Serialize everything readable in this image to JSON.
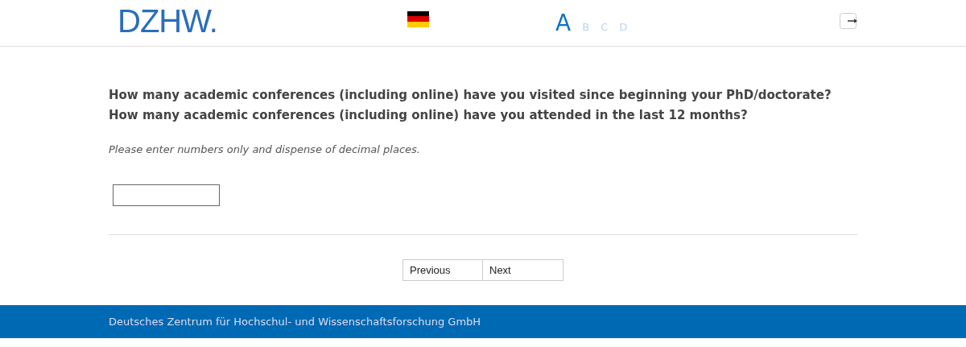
{
  "header": {
    "logo": "DZHW.",
    "font_sizes": [
      {
        "label": "A",
        "selected": true
      },
      {
        "label": "B",
        "selected": false
      },
      {
        "label": "C",
        "selected": false
      },
      {
        "label": "D",
        "selected": false
      }
    ]
  },
  "questions": [
    "How many academic conferences (including online) have you visited since beginning your PhD/doctorate?",
    "How many academic conferences (including online) have you attended in the last 12 months?"
  ],
  "instruction": "Please enter numbers only and dispense of decimal places.",
  "buttons": [
    "Previous",
    "Next"
  ],
  "footer": {
    "text": "Deutsches Zentrum für Hochschul- und Wissenschaftsforschung GmbH"
  }
}
